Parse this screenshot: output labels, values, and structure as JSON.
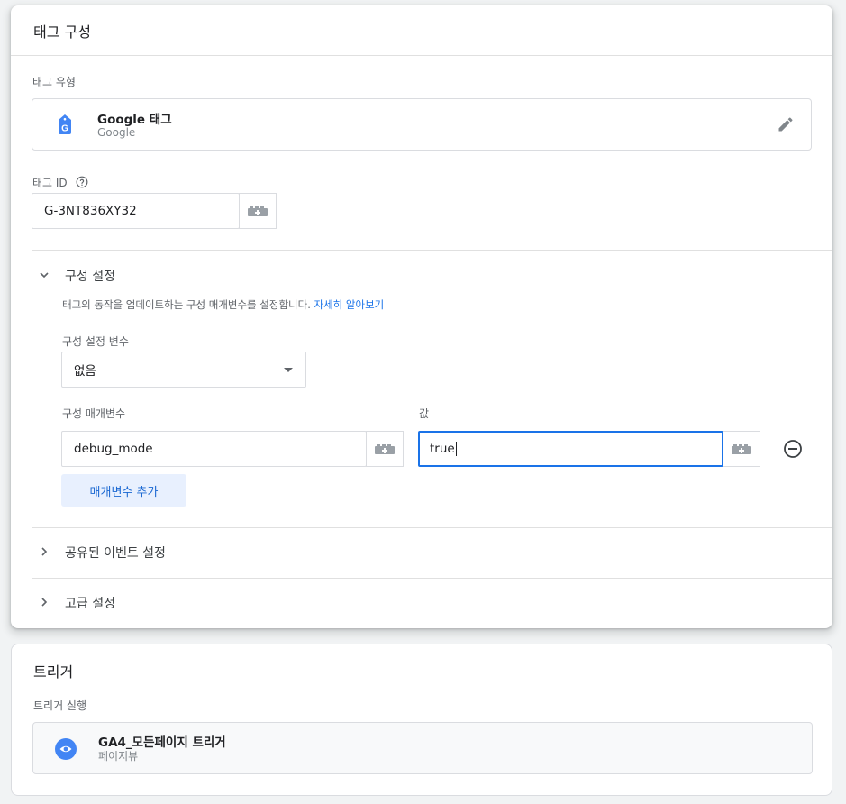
{
  "config_card": {
    "title": "태그 구성",
    "tag_type_label": "태그 유형",
    "tag_type": {
      "name": "Google 태그",
      "provider": "Google",
      "icon": "google-tag-icon",
      "edit_icon": "pencil-icon"
    },
    "tag_id_label": "태그 ID",
    "help_icon": "help-circle-icon",
    "tag_id_value": "G-3NT836XY32",
    "sections": {
      "config_settings": {
        "title": "구성 설정",
        "expanded": true,
        "description": "태그의 동작을 업데이트하는 구성 매개변수를 설정합니다.",
        "learn_more": "자세히 알아보기",
        "config_var_label": "구성 설정 변수",
        "config_var_value": "없음",
        "param_label": "구성 매개변수",
        "value_label": "값",
        "params": [
          {
            "name": "debug_mode",
            "value": "true"
          }
        ],
        "add_param_button": "매개변수 추가"
      },
      "shared_events": {
        "title": "공유된 이벤트 설정",
        "expanded": false
      },
      "advanced": {
        "title": "고급 설정",
        "expanded": false
      }
    }
  },
  "trigger_card": {
    "title": "트리거",
    "firing_label": "트리거 실행",
    "trigger": {
      "name": "GA4_모든페이지 트리거",
      "type": "페이지뷰",
      "icon": "eye-icon"
    }
  },
  "colors": {
    "accent": "#1a73e8",
    "add_button_bg": "#e8f0fe",
    "tag_icon": "#4285f4"
  }
}
